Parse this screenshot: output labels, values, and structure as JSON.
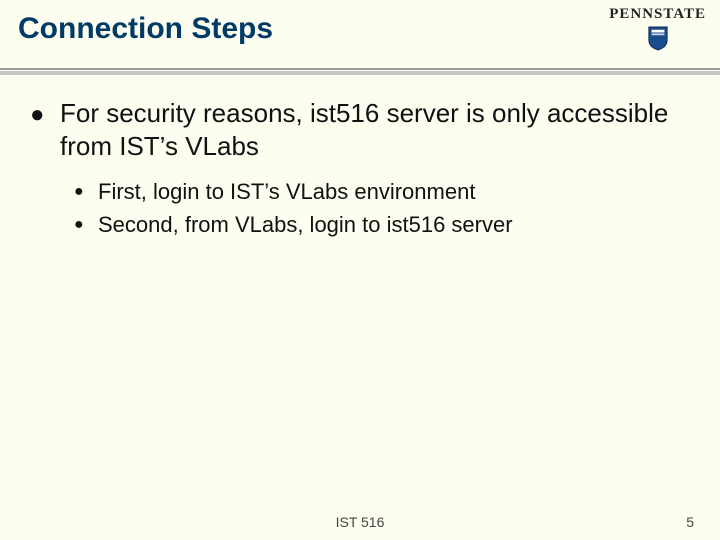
{
  "header": {
    "title": "Connection Steps",
    "logo_text": "PENNSTATE"
  },
  "content": {
    "main_point": "For security reasons, ist516 server is only accessible from IST’s VLabs",
    "sub_points": [
      "First, login to IST’s VLabs environment",
      "Second, from VLabs, login to ist516 server"
    ]
  },
  "footer": {
    "center": "IST 516",
    "page": "5"
  }
}
